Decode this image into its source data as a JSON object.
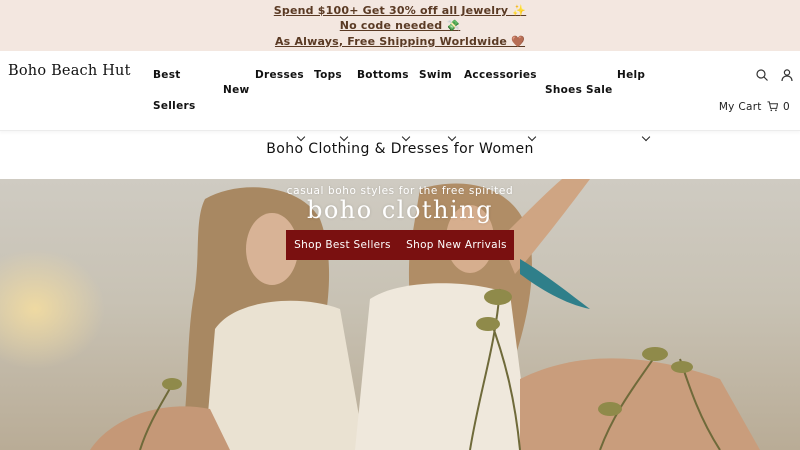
{
  "announcement": {
    "line1": "Spend $100+ Get 30% off all Jewelry ✨",
    "line2": "No code needed 💸",
    "line3": "As Always, Free Shipping Worldwide 🤎"
  },
  "header": {
    "logo": "Boho Beach Hut",
    "nav": {
      "best_sellers_1": "Best",
      "best_sellers_2": "Sellers",
      "new": "New",
      "dresses": "Dresses",
      "tops": "Tops",
      "bottoms": "Bottoms",
      "swim": "Swim",
      "accessories": "Accessories",
      "shoes": "Shoes",
      "sale": "Sale",
      "help": "Help"
    },
    "icons": {
      "search": "search-icon",
      "account": "user-icon",
      "cart": "cart-icon"
    },
    "cart_label": "My Cart",
    "cart_count": "0"
  },
  "page": {
    "title": "Boho Clothing & Dresses for Women"
  },
  "hero": {
    "subtitle": "casual boho styles for the free spirited",
    "title": "boho clothing",
    "button_best": "Shop Best Sellers",
    "button_new": "Shop New Arrivals"
  },
  "colors": {
    "announcement_bg": "#f3e7e0",
    "announcement_text": "#5a3a24",
    "button_bg": "#7a1010"
  }
}
